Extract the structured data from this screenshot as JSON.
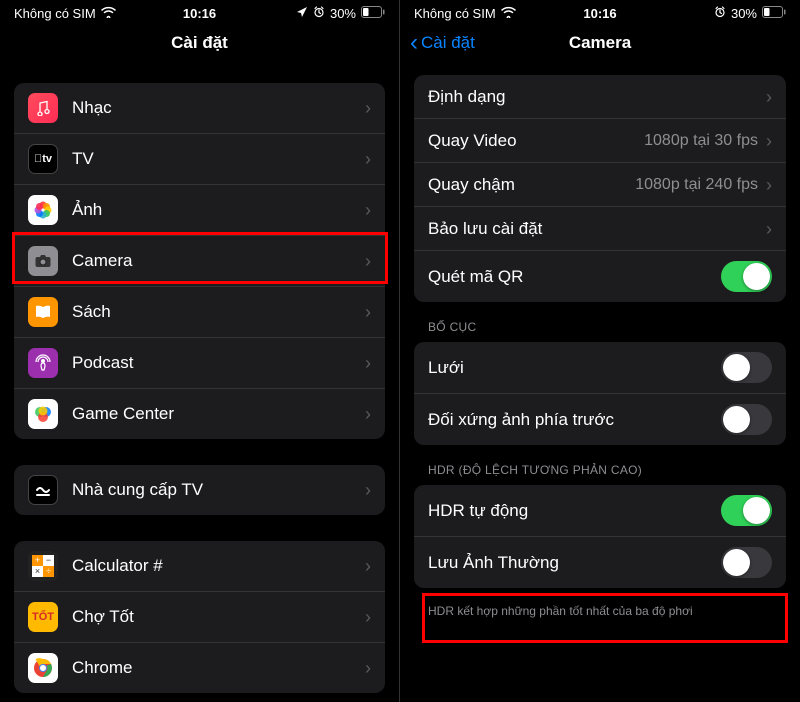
{
  "status": {
    "carrier": "Không có SIM",
    "time": "10:16",
    "battery": "30%"
  },
  "left": {
    "title": "Cài đặt",
    "groups": [
      {
        "items": [
          {
            "icon": "music",
            "label": "Nhạc"
          },
          {
            "icon": "tv",
            "label": "TV"
          },
          {
            "icon": "photos",
            "label": "Ảnh"
          },
          {
            "icon": "camera",
            "label": "Camera",
            "highlight": true
          },
          {
            "icon": "books",
            "label": "Sách"
          },
          {
            "icon": "podcast",
            "label": "Podcast"
          },
          {
            "icon": "gamecenter",
            "label": "Game Center"
          }
        ]
      },
      {
        "items": [
          {
            "icon": "tvprovider",
            "label": "Nhà cung cấp TV"
          }
        ]
      },
      {
        "items": [
          {
            "icon": "calculator",
            "label": "Calculator #"
          },
          {
            "icon": "chotot",
            "label": "Chợ Tốt"
          },
          {
            "icon": "chrome",
            "label": "Chrome"
          }
        ]
      }
    ]
  },
  "right": {
    "back": "Cài đặt",
    "title": "Camera",
    "groups": [
      {
        "items": [
          {
            "label": "Định dạng",
            "type": "chevron"
          },
          {
            "label": "Quay Video",
            "value": "1080p tại 30 fps",
            "type": "chevron"
          },
          {
            "label": "Quay chậm",
            "value": "1080p tại 240 fps",
            "type": "chevron"
          },
          {
            "label": "Bảo lưu cài đặt",
            "type": "chevron"
          },
          {
            "label": "Quét mã QR",
            "type": "toggle",
            "on": true
          }
        ]
      },
      {
        "header": "BỐ CỤC",
        "items": [
          {
            "label": "Lưới",
            "type": "toggle",
            "on": false
          },
          {
            "label": "Đối xứng ảnh phía trước",
            "type": "toggle",
            "on": false
          }
        ]
      },
      {
        "header": "HDR (ĐỘ LỆCH TƯƠNG PHẢN CAO)",
        "items": [
          {
            "label": "HDR tự động",
            "type": "toggle",
            "on": true,
            "highlight": true
          },
          {
            "label": "Lưu Ảnh Thường",
            "type": "toggle",
            "on": false
          }
        ],
        "footer": "HDR kết hợp những phần tốt nhất của ba độ phơi"
      }
    ]
  }
}
